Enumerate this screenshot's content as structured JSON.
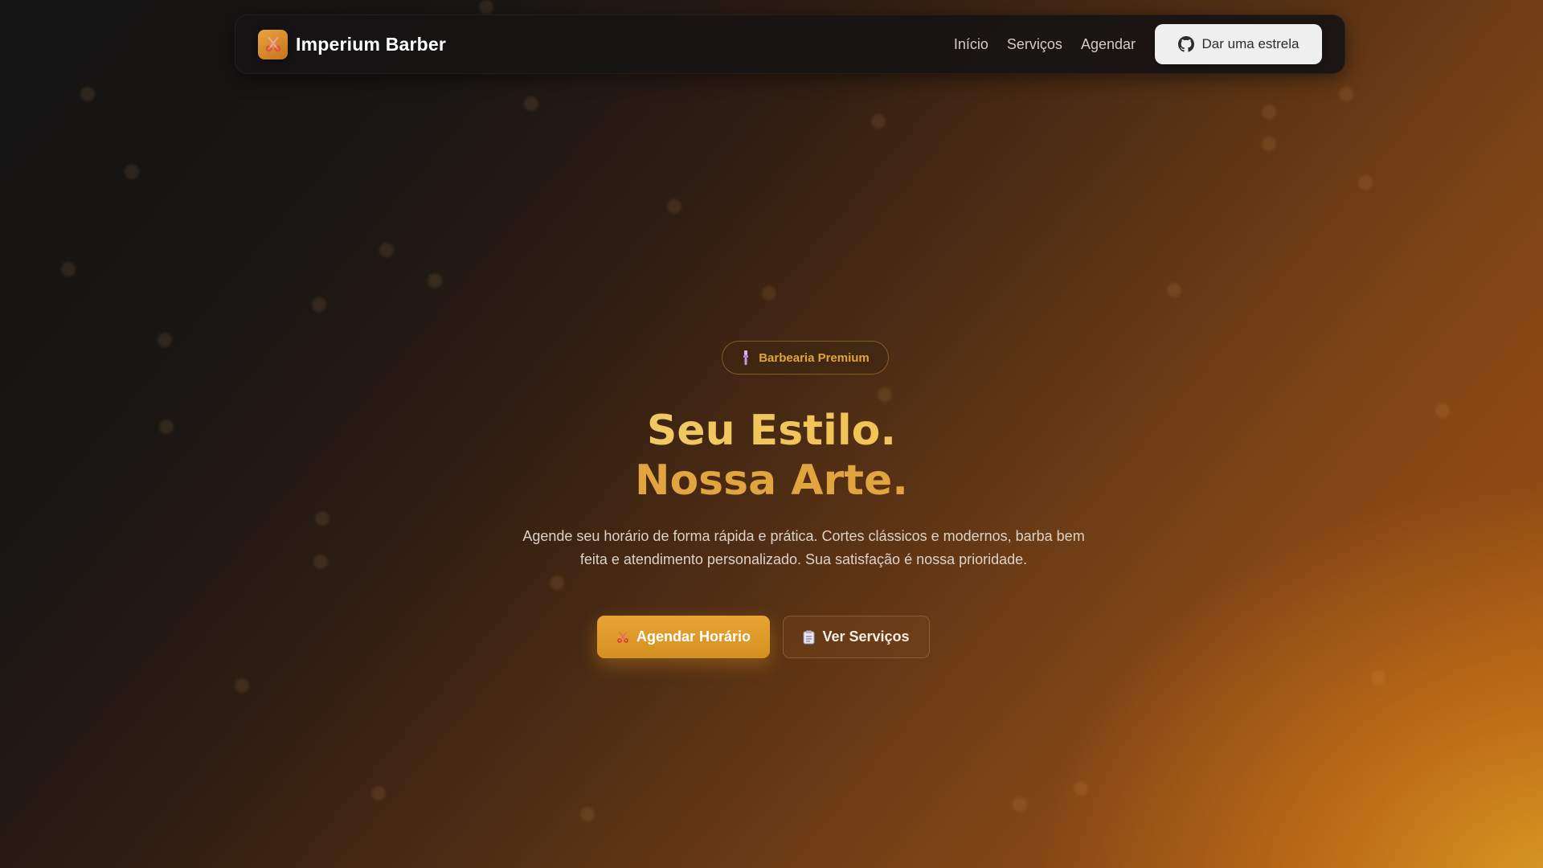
{
  "nav": {
    "brand_name": "Imperium Barber",
    "links": [
      "Início",
      "Serviços",
      "Agendar"
    ],
    "star_button_label": "Dar uma estrela"
  },
  "hero": {
    "badge_label": "Barbearia Premium",
    "headline_line1": "Seu Estilo.",
    "headline_line2": "Nossa Arte.",
    "subtitle": "Agende seu horário de forma rápida e prática. Cortes clássicos e modernos, barba bem feita e atendimento personalizado. Sua satisfação é nossa prioridade.",
    "primary_cta": "Agendar Horário",
    "secondary_cta": "Ver Serviços"
  },
  "icons": {
    "brand": "scissors-icon",
    "star_button": "github-icon",
    "badge": "razor-icon",
    "primary_cta": "scissors-icon",
    "secondary_cta": "clipboard-icon"
  },
  "colors": {
    "accent": "#E0A43A",
    "primary_button": "#E0A033",
    "navbar": "#161414",
    "background_dark": "#141414",
    "background_warm": "#A65812"
  }
}
